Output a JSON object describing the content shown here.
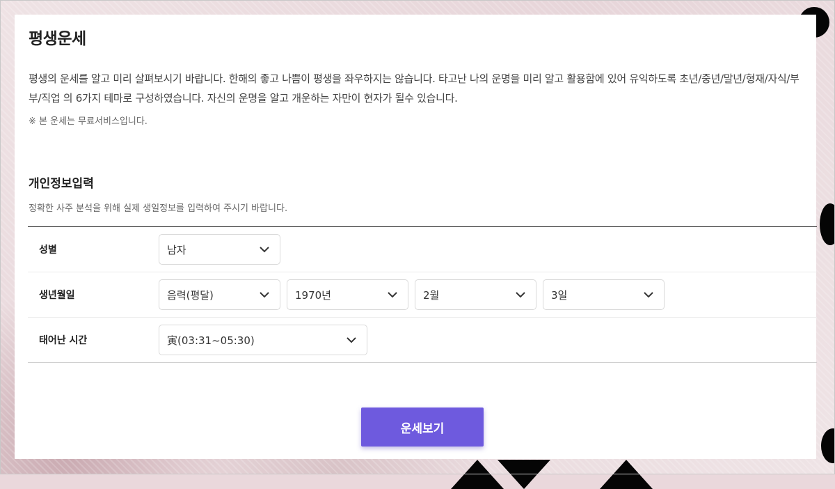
{
  "page": {
    "title": "평생운세",
    "intro": "평생의 운세를 알고 미리 살펴보시기 바랍니다. 한해의 좋고 나쁨이 평생을 좌우하지는 않습니다. 타고난 나의 운명을 미리 알고 활용함에 있어 유익하도록 초년/중년/말년/형재/자식/부부/직업 의 6가지 테마로 구성하였습니다. 자신의 운명을 알고 개운하는 자만이 현자가 될수 있습니다.",
    "free_note": "※ 본 운세는 무료서비스입니다."
  },
  "personal_info": {
    "title": "개인정보입력",
    "description": "정확한 사주 분석을 위해 실제 생일정보를 입력하여 주시기 바랍니다.",
    "gender": {
      "label": "성별",
      "selected": "남자"
    },
    "birthday": {
      "label": "생년월일",
      "calendar_type": "음력(평달)",
      "year": "1970년",
      "month": "2월",
      "day": "3일"
    },
    "birth_time": {
      "label": "태어난 시간",
      "selected": "寅(03:31~05:30)"
    }
  },
  "submit": {
    "label": "운세보기"
  },
  "colors": {
    "accent": "#6e5ade",
    "card_background": "#ffffff",
    "page_background": "#ead8dc"
  },
  "icons": {
    "select_arrow": "chevron-down-icon"
  }
}
